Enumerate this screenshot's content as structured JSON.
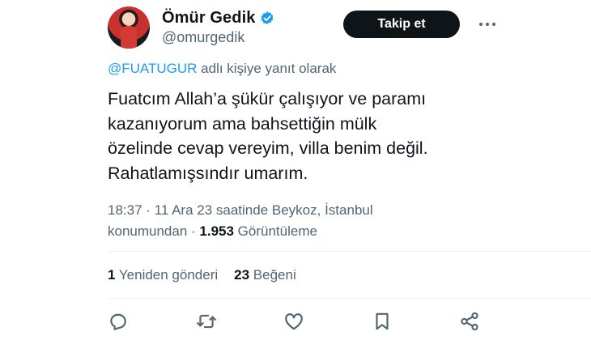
{
  "author": {
    "name": "Ömür Gedik",
    "handle": "@omurgedik",
    "follow_label": "Takip et"
  },
  "reply": {
    "mention": "@FUATUGUR",
    "suffix": " adlı kişiye yanıt olarak"
  },
  "tweet": {
    "text": "Fuatcım Allah’a şükür çalışıyor ve paramı\nkazanıyorum ama bahsettiğin mülk\nözelinde cevap vereyim, villa benim değil.\nRahatlamışsındır umarım."
  },
  "meta": {
    "time_location": "18:37 · 11 Ara 23 saatinde Beykoz, İstanbul",
    "location_suffix": "konumundan · ",
    "views_count": "1.953",
    "views_label": " Görüntüleme"
  },
  "stats": {
    "retweets_count": "1",
    "retweets_label": " Yeniden gönderi",
    "likes_count": "23",
    "likes_label": " Beğeni"
  },
  "colors": {
    "accent": "#1d9bf0",
    "text": "#0f1419",
    "secondary": "#536471"
  },
  "icons": [
    "verified-badge-icon",
    "more-options-icon",
    "reply-icon",
    "retweet-icon",
    "like-icon",
    "bookmark-icon",
    "share-icon"
  ]
}
